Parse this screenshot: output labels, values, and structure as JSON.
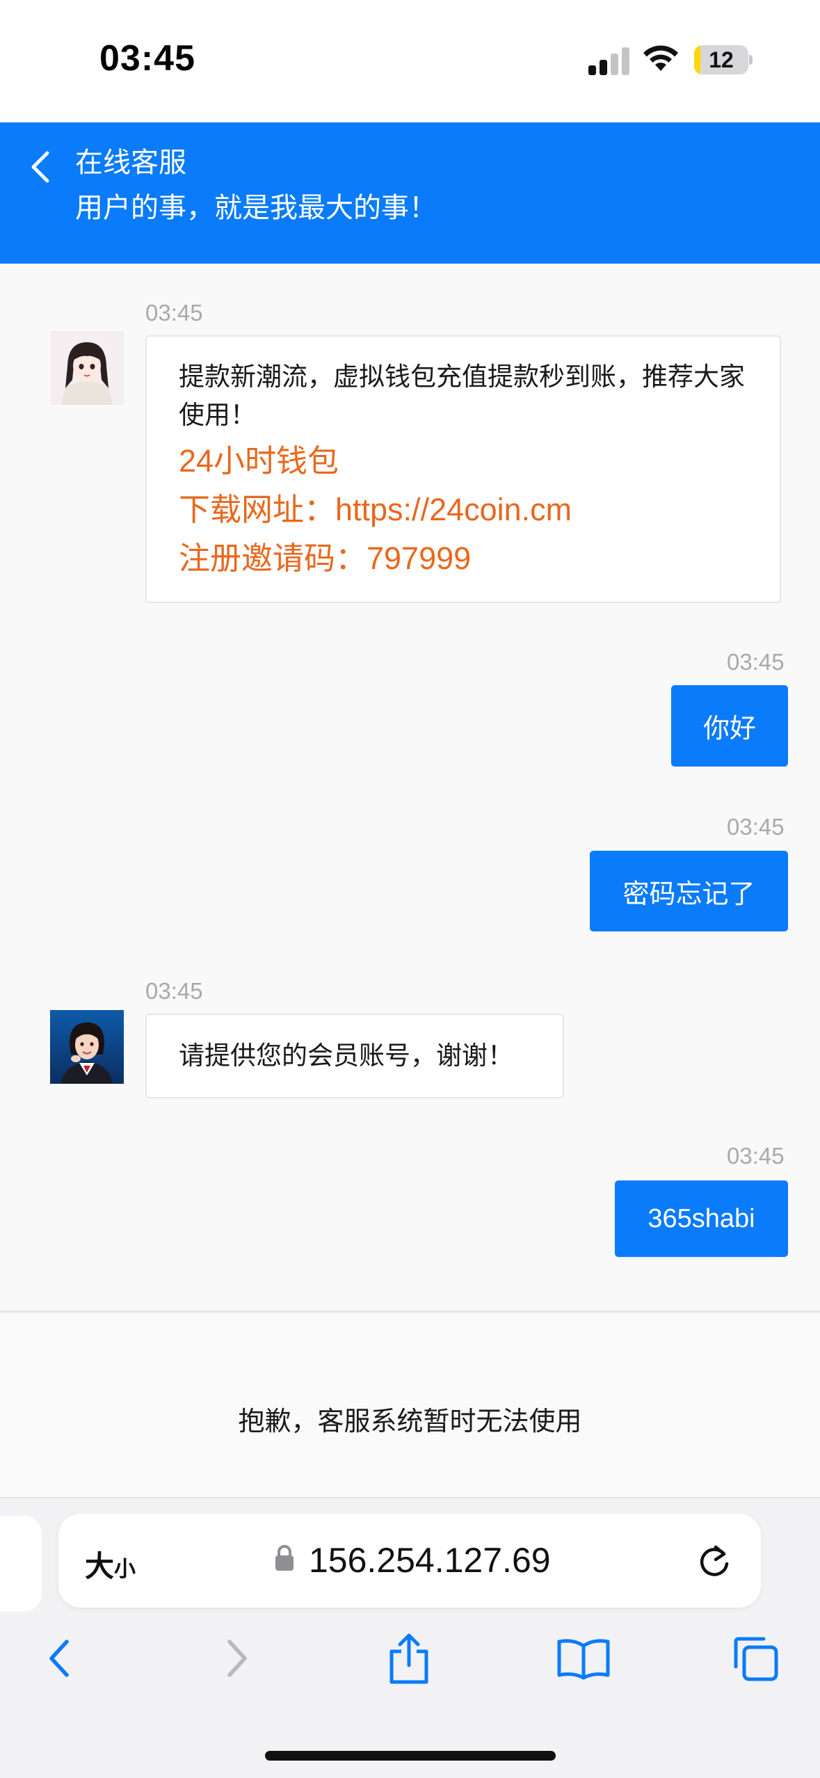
{
  "status_bar": {
    "time": "03:45",
    "battery_level": "12",
    "battery_fraction": 0.12,
    "signal_bars_active": 2,
    "signal_bars_total": 4
  },
  "header": {
    "title": "在线客服",
    "subtitle": "用户的事，就是我最大的事！",
    "background_color": "#0a7bfa"
  },
  "messages": [
    {
      "side": "incoming",
      "time": "03:45",
      "avatar": "female-avatar-illustration",
      "text": "提款新潮流，虚拟钱包充值提款秒到账，推荐大家使用！",
      "highlight_lines": [
        "24小时钱包",
        "下载网址：https://24coin.cm",
        "注册邀请码：797999"
      ]
    },
    {
      "side": "outgoing",
      "time": "03:45",
      "text": "你好"
    },
    {
      "side": "outgoing",
      "time": "03:45",
      "text": "密码忘记了"
    },
    {
      "side": "incoming",
      "time": "03:45",
      "avatar": "customer-service-agent-photo",
      "text": "请提供您的会员账号，谢谢！"
    },
    {
      "side": "outgoing",
      "time": "03:45",
      "text": "365shabi"
    }
  ],
  "notice": {
    "text": "抱歉，客服系统暂时无法使用"
  },
  "safari": {
    "text_size_big": "大",
    "text_size_small": "小",
    "url": "156.254.127.69",
    "toolbar_icons": [
      "back-icon",
      "forward-icon",
      "share-icon",
      "bookmarks-icon",
      "tabs-icon"
    ],
    "accent_color": "#0a7bfa"
  }
}
